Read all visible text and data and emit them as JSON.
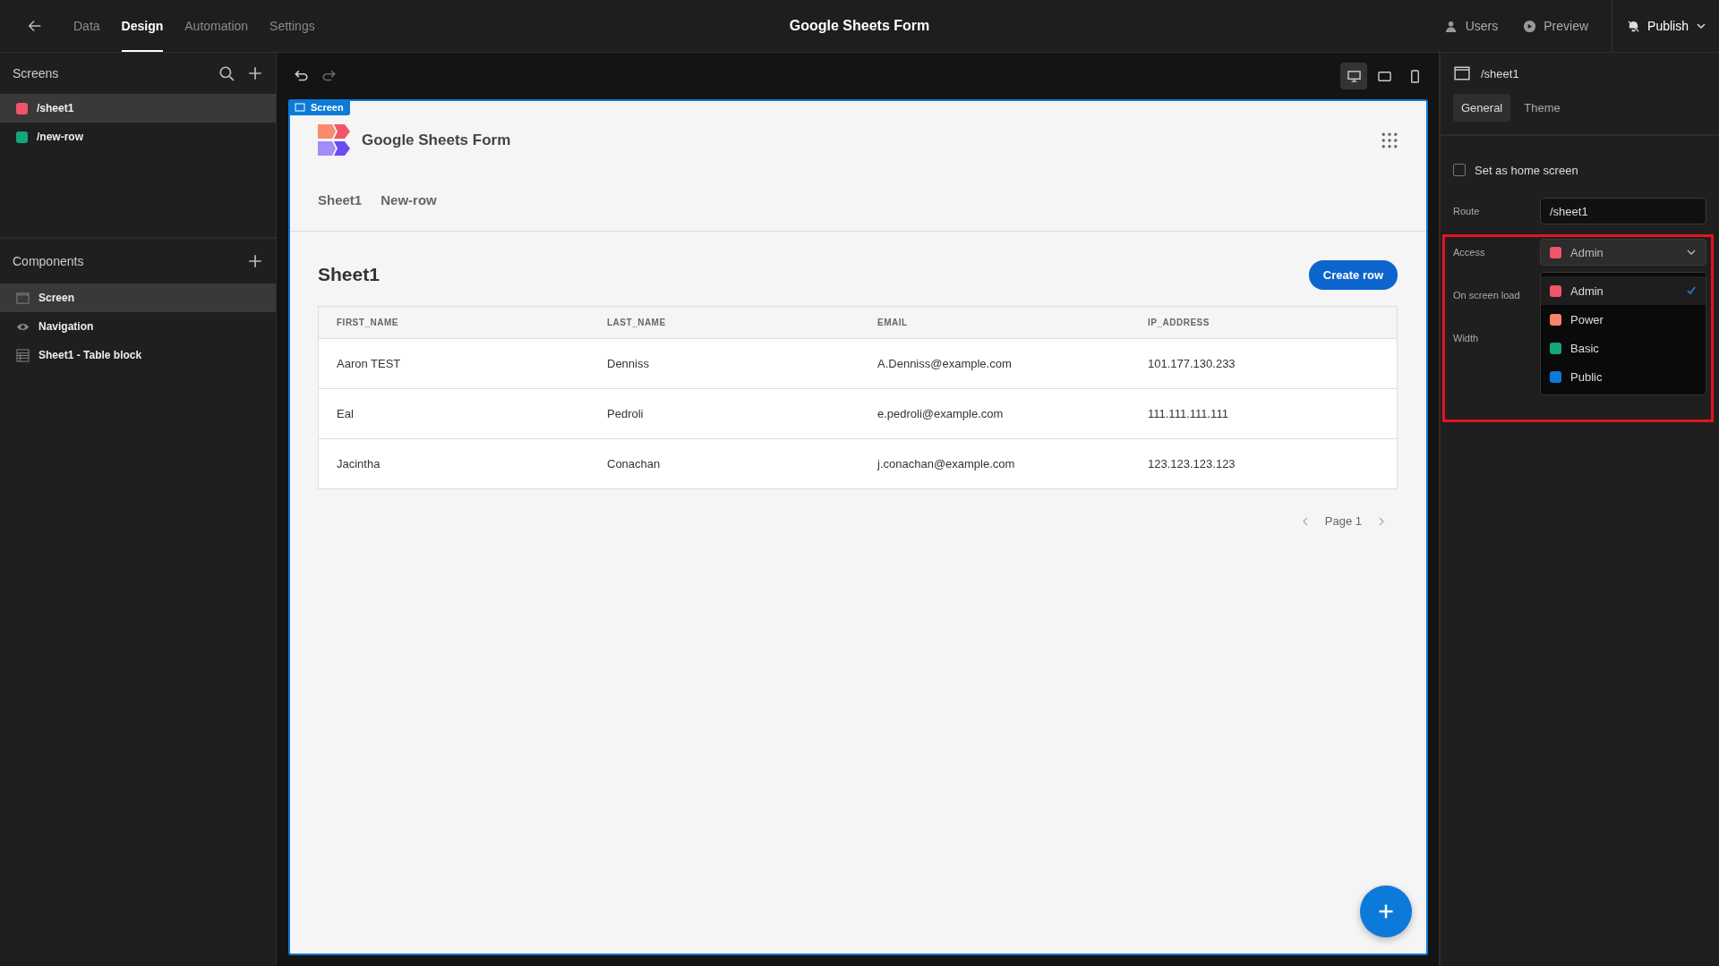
{
  "topbar": {
    "tabs": [
      {
        "label": "Data",
        "selected": false
      },
      {
        "label": "Design",
        "selected": true
      },
      {
        "label": "Automation",
        "selected": false
      },
      {
        "label": "Settings",
        "selected": false
      }
    ],
    "title": "Google Sheets Form",
    "actions": [
      {
        "label": "Users",
        "kind": "users"
      },
      {
        "label": "Preview",
        "kind": "preview"
      },
      {
        "label": "Publish",
        "kind": "publish"
      }
    ]
  },
  "sidebar": {
    "screens_title": "Screens",
    "screens": [
      {
        "route": "/sheet1",
        "color": "#f0556a",
        "selected": true
      },
      {
        "route": "/new-row",
        "color": "#12a67d",
        "selected": false
      }
    ],
    "components_title": "Components",
    "components": [
      {
        "label": "Screen",
        "kind": "screen",
        "selected": true
      },
      {
        "label": "Navigation",
        "kind": "navigation",
        "selected": false
      },
      {
        "label": "Sheet1 - Table block",
        "kind": "table",
        "selected": false
      }
    ]
  },
  "toolbar": {
    "devices": [
      {
        "kind": "desktop",
        "selected": true
      },
      {
        "kind": "tablet",
        "selected": false
      },
      {
        "kind": "mobile",
        "selected": false
      }
    ]
  },
  "canvas": {
    "screen_tag": "Screen",
    "app_title": "Google Sheets Form",
    "nav": [
      "Sheet1",
      "New-row"
    ],
    "page_title": "Sheet1",
    "create_button": "Create row",
    "table": {
      "columns": [
        "FIRST_NAME",
        "LAST_NAME",
        "EMAIL",
        "IP_ADDRESS"
      ],
      "rows": [
        [
          "Aaron TEST",
          "Denniss",
          "A.Denniss@example.com",
          "101.177.130.233"
        ],
        [
          "Eal",
          "Pedroli",
          "e.pedroli@example.com",
          "111.111.111.111"
        ],
        [
          "Jacintha",
          "Conachan",
          "j.conachan@example.com",
          "123.123.123.123"
        ]
      ]
    },
    "pagination": "Page 1"
  },
  "panel": {
    "title": "/sheet1",
    "tabs": [
      {
        "label": "General",
        "selected": true
      },
      {
        "label": "Theme",
        "selected": false
      }
    ],
    "home_screen": {
      "label": "Set as home screen",
      "checked": false
    },
    "route": {
      "label": "Route",
      "value": "/sheet1"
    },
    "access": {
      "label": "Access",
      "value": "Admin",
      "color": "#f0556a"
    },
    "labels": [
      "On screen load",
      "Width"
    ],
    "options": [
      {
        "label": "Admin",
        "color": "#f0556a",
        "selected": true
      },
      {
        "label": "Power",
        "color": "#fb8468",
        "selected": false
      },
      {
        "label": "Basic",
        "color": "#12a67d",
        "selected": false
      },
      {
        "label": "Public",
        "color": "#0c7ad8",
        "selected": false
      }
    ]
  }
}
